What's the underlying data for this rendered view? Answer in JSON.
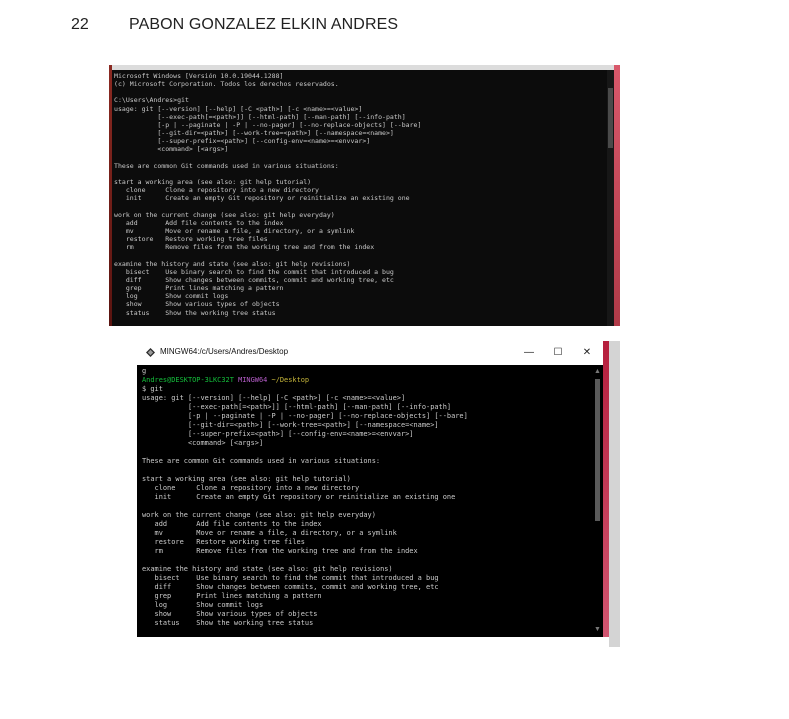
{
  "page": {
    "number": "22",
    "author": "PABON GONZALEZ ELKIN ANDRES"
  },
  "cmd": {
    "output": "Microsoft Windows [Versión 10.0.19044.1288]\n(c) Microsoft Corporation. Todos los derechos reservados.\n\nC:\\Users\\Andres>git\nusage: git [--version] [--help] [-C <path>] [-c <name>=<value>]\n           [--exec-path[=<path>]] [--html-path] [--man-path] [--info-path]\n           [-p | --paginate | -P | --no-pager] [--no-replace-objects] [--bare]\n           [--git-dir=<path>] [--work-tree=<path>] [--namespace=<name>]\n           [--super-prefix=<path>] [--config-env=<name>=<envvar>]\n           <command> [<args>]\n\nThese are common Git commands used in various situations:\n\nstart a working area (see also: git help tutorial)\n   clone     Clone a repository into a new directory\n   init      Create an empty Git repository or reinitialize an existing one\n\nwork on the current change (see also: git help everyday)\n   add       Add file contents to the index\n   mv        Move or rename a file, a directory, or a symlink\n   restore   Restore working tree files\n   rm        Remove files from the working tree and from the index\n\nexamine the history and state (see also: git help revisions)\n   bisect    Use binary search to find the commit that introduced a bug\n   diff      Show changes between commits, commit and working tree, etc\n   grep      Print lines matching a pattern\n   log       Show commit logs\n   show      Show various types of objects\n   status    Show the working tree status"
  },
  "mingw": {
    "title": "MINGW64:/c/Users/Andres/Desktop",
    "controls": {
      "minimize": "—",
      "maximize": "☐",
      "close": "✕"
    },
    "first_line": "g",
    "prompt_user": "Andres@DESKTOP-3LKC32T",
    "prompt_sys": "MINGW64",
    "prompt_path": "~/Desktop",
    "command_line": "$ git",
    "output": "usage: git [--version] [--help] [-C <path>] [-c <name>=<value>]\n           [--exec-path[=<path>]] [--html-path] [--man-path] [--info-path]\n           [-p | --paginate | -P | --no-pager] [--no-replace-objects] [--bare]\n           [--git-dir=<path>] [--work-tree=<path>] [--namespace=<name>]\n           [--super-prefix=<path>] [--config-env=<name>=<envvar>]\n           <command> [<args>]\n\nThese are common Git commands used in various situations:\n\nstart a working area (see also: git help tutorial)\n   clone     Clone a repository into a new directory\n   init      Create an empty Git repository or reinitialize an existing one\n\nwork on the current change (see also: git help everyday)\n   add       Add file contents to the index\n   mv        Move or rename a file, a directory, or a symlink\n   restore   Restore working tree files\n   rm        Remove files from the working tree and from the index\n\nexamine the history and state (see also: git help revisions)\n   bisect    Use binary search to find the commit that introduced a bug\n   diff      Show changes between commits, commit and working tree, etc\n   grep      Print lines matching a pattern\n   log       Show commit logs\n   show      Show various types of objects\n   status    Show the working tree status"
  },
  "colors": {
    "prompt_user": "#14bf3b",
    "prompt_sys": "#b65dc9",
    "prompt_path": "#c6b63a",
    "window_accent": "#d15570"
  },
  "icons": {
    "mingw_app": "mingw-diamond-icon",
    "scroll_up": "scroll-up-arrow-icon",
    "scroll_down": "scroll-down-arrow-icon"
  }
}
